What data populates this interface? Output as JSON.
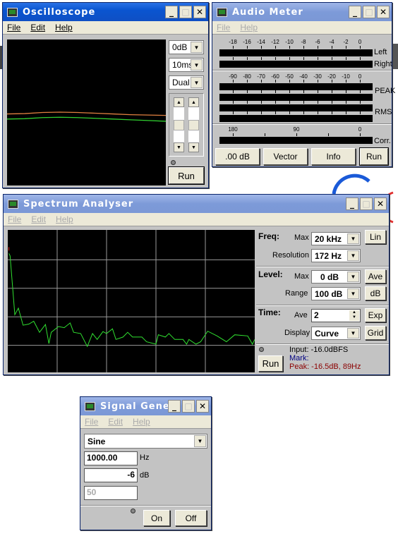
{
  "oscilloscope": {
    "title": "Oscilloscope",
    "menu": [
      "File",
      "Edit",
      "Help"
    ],
    "gain": "0dB",
    "timebase": "10ms",
    "mode": "Dual",
    "run_label": "Run",
    "colors": {
      "ch1": "#e08040",
      "ch2": "#30d030"
    },
    "chart_data": {
      "type": "line",
      "series": [
        {
          "values": [
            -0.02,
            -0.015,
            0.0,
            0.005,
            0.0,
            -0.01,
            -0.02,
            -0.03,
            -0.035,
            -0.04
          ]
        },
        {
          "values": [
            -0.09,
            -0.085,
            -0.07,
            -0.065,
            -0.07,
            -0.08,
            -0.09,
            -0.1,
            -0.11,
            -0.12
          ]
        }
      ],
      "ylim": [
        -1,
        1
      ]
    }
  },
  "audio_meter": {
    "title": "Audio Meter",
    "menu": [
      "File",
      "Help"
    ],
    "level_scale": [
      "-18",
      "-16",
      "-14",
      "-12",
      "-10",
      "-8",
      "-6",
      "-4",
      "-2",
      "0"
    ],
    "level_labels": [
      "Left",
      "Right"
    ],
    "db_scale": [
      "-90",
      "-80",
      "-70",
      "-60",
      "-50",
      "-40",
      "-30",
      "-20",
      "-10",
      "0"
    ],
    "peak_label": "PEAK",
    "rms_label": "RMS",
    "corr_scale": [
      "180",
      "90",
      "0"
    ],
    "corr_label": "Corr.",
    "buttons": {
      "zero": ".00 dB",
      "vector": "Vector",
      "info": "Info",
      "run": "Run"
    }
  },
  "spectrum": {
    "title": "Spectrum Analyser",
    "menu": [
      "File",
      "Edit",
      "Help"
    ],
    "freq": {
      "heading": "Freq:",
      "max_label": "Max",
      "max": "20 kHz",
      "lin": "Lin",
      "res_label": "Resolution",
      "res": "172 Hz"
    },
    "level": {
      "heading": "Level:",
      "max_label": "Max",
      "max": "0 dB",
      "ave": "Ave",
      "range_label": "Range",
      "range": "100 dB",
      "db": "dB"
    },
    "time": {
      "heading": "Time:",
      "ave_label": "Ave",
      "ave": "2",
      "exp": "Exp",
      "display_label": "Display",
      "display": "Curve",
      "grid": "Grid"
    },
    "run_label": "Run",
    "readout": {
      "input": "Input: -16.0dBFS",
      "mark": "Mark:",
      "peak": "Peak: -16.5dB, 89Hz"
    },
    "colors": {
      "curve": "#30e030",
      "grid": "#9a9a9a",
      "peak_marker": "#e02020",
      "mark": "#000080",
      "peak": "#8b0000"
    },
    "chart_data": {
      "type": "line",
      "xlim_khz": [
        0,
        20
      ],
      "ylim_db": [
        -100,
        0
      ],
      "grid": true,
      "x_khz": [
        0.09,
        0.19,
        0.57,
        0.86,
        1.24,
        1.71,
        2.1,
        2.57,
        3.05,
        3.33,
        3.52,
        4.1,
        4.57,
        5.05,
        5.33,
        5.9,
        6.44,
        6.86,
        7.24,
        7.71,
        8.0,
        8.48,
        8.76,
        9.33,
        9.71,
        10.1,
        10.86,
        11.24,
        12.0,
        12.19,
        12.76,
        13.05,
        13.52,
        14.19,
        14.48,
        14.67,
        15.24,
        15.62,
        16.19,
        16.95,
        17.71,
        18.38,
        19.43,
        19.81,
        20.0
      ],
      "y_db": [
        -16.5,
        -18.2,
        -59.5,
        -54.9,
        -66.9,
        -66.1,
        -64.1,
        -71.9,
        -66.4,
        -79.8,
        -71.9,
        -67.8,
        -68.6,
        -65.3,
        -71.9,
        -72.7,
        -81.8,
        -72.7,
        -76.9,
        -71.4,
        -72.7,
        -69.4,
        -76.9,
        -75.2,
        -71.9,
        -75.2,
        -75.2,
        -78.5,
        -80.2,
        -73.6,
        -75.2,
        -72.7,
        -76.9,
        -76.9,
        -80.2,
        -76.9,
        -80.2,
        -78.5,
        -71.1,
        -74.4,
        -78.5,
        -73.6,
        -74.4,
        -80.2,
        -76.9
      ]
    }
  },
  "signal_generator": {
    "title": "Signal Genera...",
    "menu": [
      "File",
      "Edit",
      "Help"
    ],
    "waveform": "Sine",
    "frequency": "1000.00",
    "freq_unit": "Hz",
    "level": "-6",
    "level_unit": "dB",
    "duty": "50",
    "on_label": "On",
    "off_label": "Off"
  }
}
